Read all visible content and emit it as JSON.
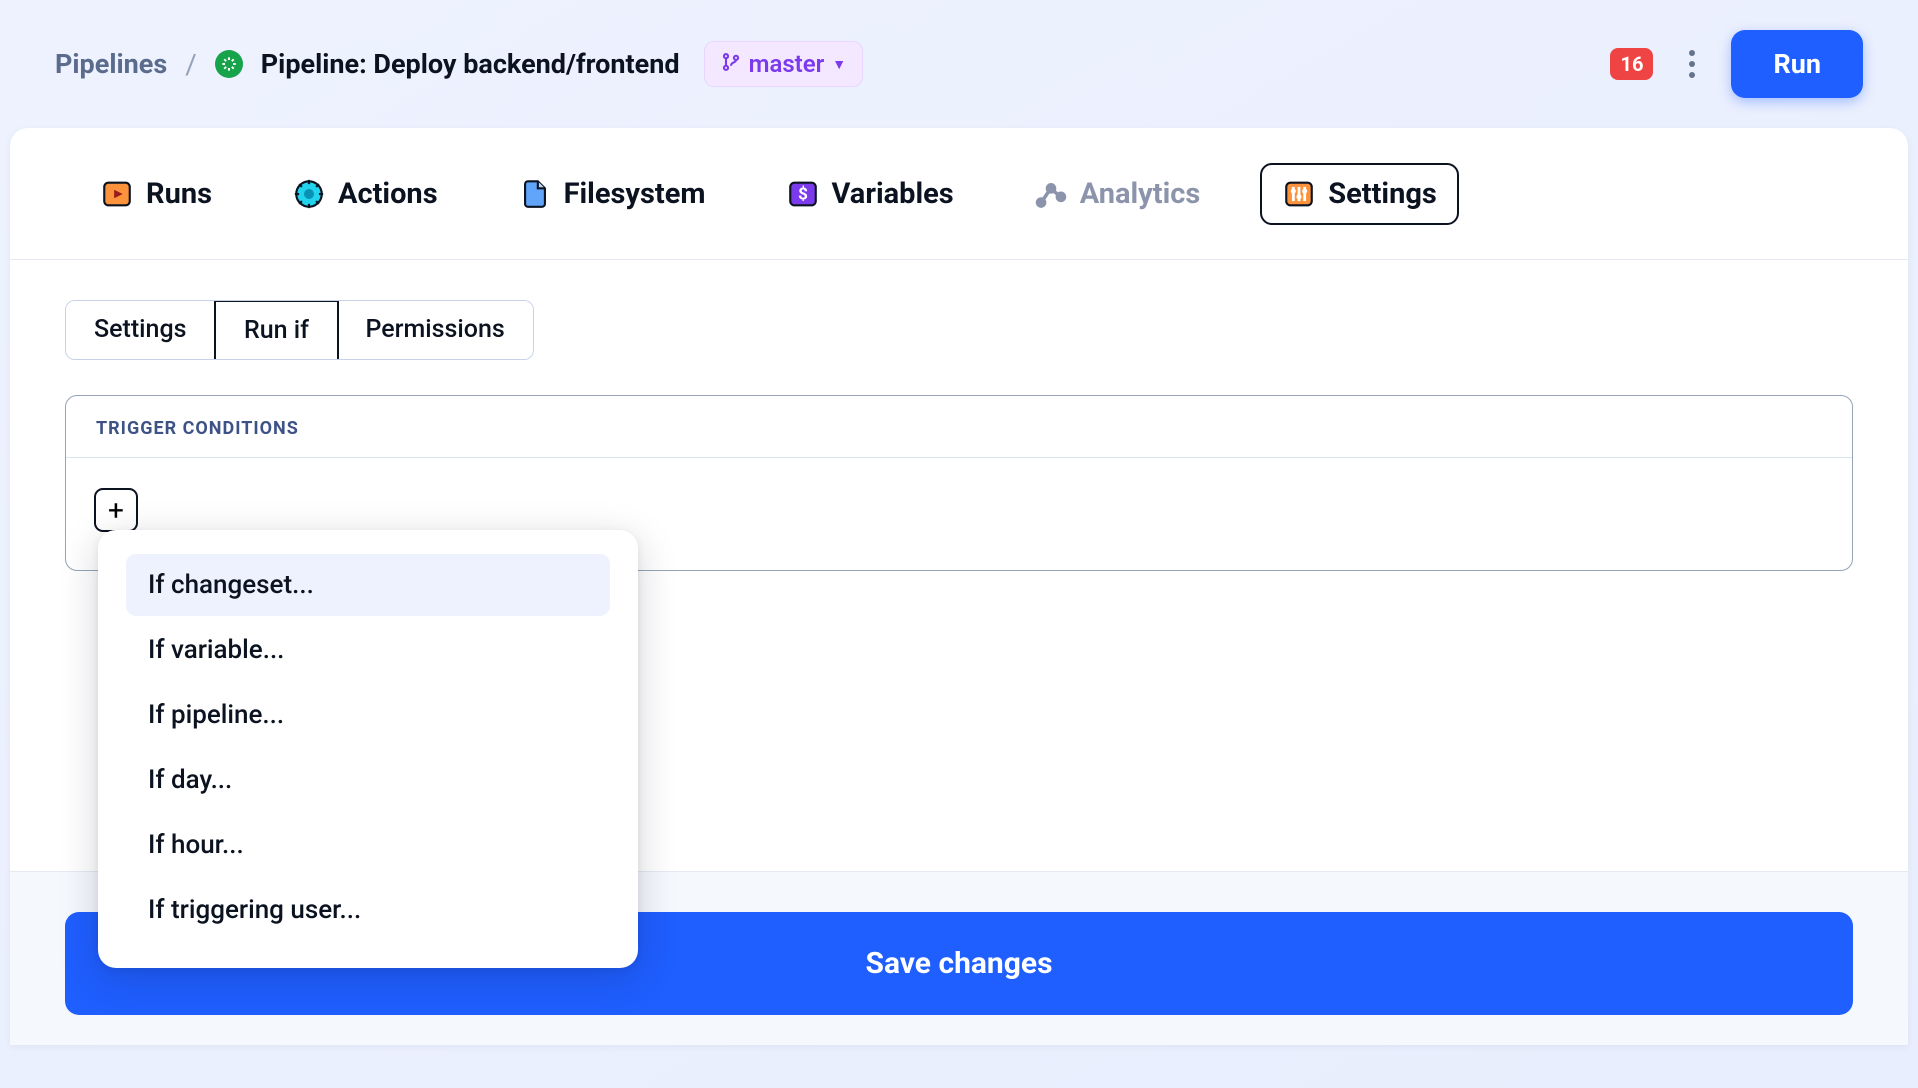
{
  "header": {
    "breadcrumb_root": "Pipelines",
    "pipeline_title": "Pipeline: Deploy backend/frontend",
    "branch": "master",
    "notif_count": "16",
    "run_label": "Run"
  },
  "tabs": {
    "runs": "Runs",
    "actions": "Actions",
    "filesystem": "Filesystem",
    "variables": "Variables",
    "analytics": "Analytics",
    "settings": "Settings"
  },
  "subtabs": {
    "settings": "Settings",
    "run_if": "Run if",
    "permissions": "Permissions"
  },
  "trigger": {
    "heading": "TRIGGER CONDITIONS"
  },
  "dropdown": {
    "items": [
      "If changeset...",
      "If variable...",
      "If pipeline...",
      "If day...",
      "If hour...",
      "If triggering user..."
    ]
  },
  "save_label": "Save changes",
  "colors": {
    "primary": "#1f5eff",
    "accent_purple": "#7c3aed",
    "danger": "#ef4444",
    "success": "#16a34a"
  }
}
